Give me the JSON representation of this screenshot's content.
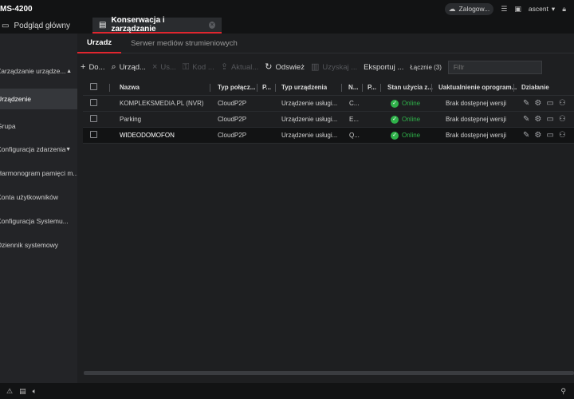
{
  "app": {
    "title": "MS-4200"
  },
  "titlebar": {
    "login_label": "Zalogow...",
    "user": "ascent"
  },
  "tabs": {
    "preview_label": "Podgląd główny",
    "active_label": "Konserwacja i zarządzanie"
  },
  "sidebar": {
    "items": [
      {
        "label": "Zarządzanie urządze...",
        "caret": "▲"
      },
      {
        "label": "Urządzenie"
      },
      {
        "label": "Grupa"
      },
      {
        "label": "Konfiguracja zdarzenia",
        "caret": "▼"
      },
      {
        "label": "Harmonogram pamięci m..."
      },
      {
        "label": "Konta użytkowników"
      },
      {
        "label": "Konfiguracja Systemu..."
      },
      {
        "label": "Dziennik systemowy"
      }
    ]
  },
  "subtabs": {
    "device": "Urzadz",
    "streaming": "Serwer mediów strumieniowych"
  },
  "toolbar": {
    "add": "Do...",
    "search": "Urząd...",
    "delete": "Us...",
    "code": "Kod ...",
    "update": "Aktual...",
    "refresh": "Odswież",
    "obtain": "Uzyskaj ...",
    "export": "Eksportuj ...",
    "total": "Łącznie (3)",
    "filter_placeholder": "Filtr"
  },
  "table": {
    "headers": {
      "name": "Nazwa",
      "conn_type": "Typ połącz...",
      "p1": "P...",
      "device_type": "Typ urządzenia",
      "n": "N...",
      "p2": "P...",
      "usage": "Stan użycia z...",
      "upgrade": "Uaktualnienie oprogram...",
      "action": "Działanie"
    },
    "rows": [
      {
        "name": "KOMPLEKSMEDIA.PL (NVR)",
        "conn": "CloudP2P",
        "type": "Urządzenie usługi...",
        "n": "C...",
        "status": "Online",
        "upgrade": "Brak dostępnej wersji"
      },
      {
        "name": "Parking",
        "conn": "CloudP2P",
        "type": "Urządzenie usługi...",
        "n": "E...",
        "status": "Online",
        "upgrade": "Brak dostępnej wersji"
      },
      {
        "name": "WIDEODOMOFON",
        "conn": "CloudP2P",
        "type": "Urządzenie usługi...",
        "n": "Q...",
        "status": "Online",
        "upgrade": "Brak dostępnej wersji"
      }
    ]
  },
  "colors": {
    "accent": "#e0262f",
    "online": "#2fb24a"
  },
  "icons": {
    "status_check": "✓"
  }
}
